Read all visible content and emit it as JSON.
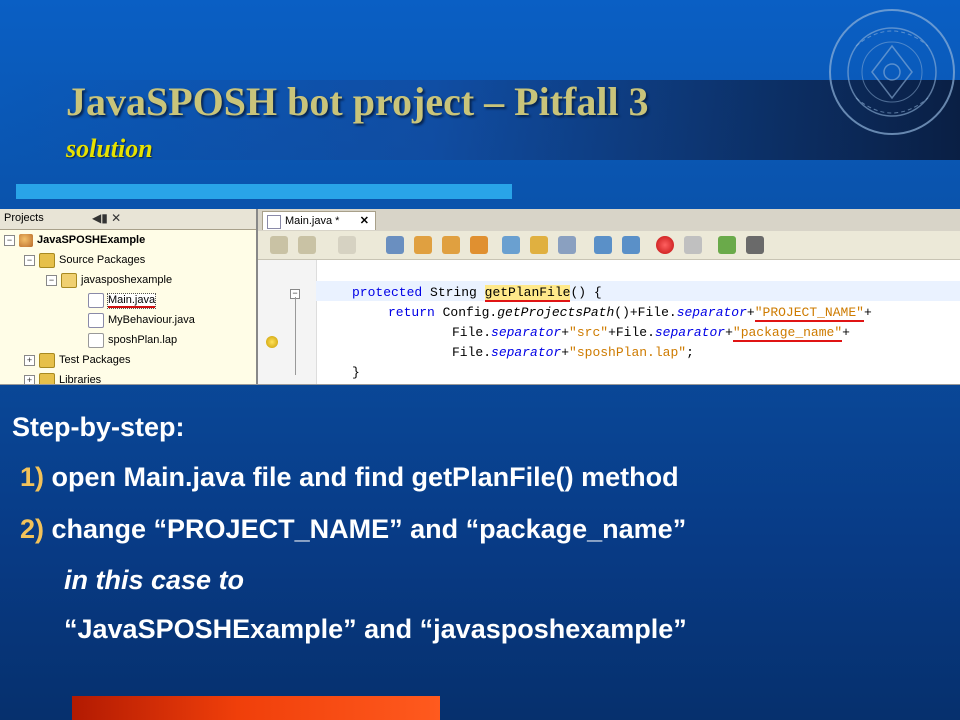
{
  "slide": {
    "title": "JavaSPOSH bot project – Pitfall 3",
    "subtitle": "solution"
  },
  "ide": {
    "projects_tab": "Projects",
    "projects_tab_controls": "◀▮ ✕",
    "tree": [
      {
        "label": "JavaSPOSHExample",
        "icon": "project-icon"
      },
      {
        "label": "Source Packages",
        "icon": "folder-icon"
      },
      {
        "label": "javasposhexample",
        "icon": "package-icon"
      },
      {
        "label": "Main.java",
        "icon": "java-file-icon"
      },
      {
        "label": "MyBehaviour.java",
        "icon": "java-file-icon"
      },
      {
        "label": "sposhPlan.lap",
        "icon": "file-icon"
      },
      {
        "label": "Test Packages",
        "icon": "folder-icon"
      },
      {
        "label": "Libraries",
        "icon": "folder-icon"
      }
    ],
    "editor_tab": "Main.java *",
    "editor_tab_close": "✕",
    "code": {
      "l1_kw": "protected",
      "l1_type": " String ",
      "l1_method": "getPlanFile",
      "l1_rest": "() {",
      "l2_kw": "return",
      "l2_a": " Config.",
      "l2_b": "getProjectsPath",
      "l2_c": "()+File.",
      "l2_d": "separator",
      "l2_e": "+",
      "l2_str": "\"PROJECT_NAME\"",
      "l2_f": "+",
      "l3_a": "File.",
      "l3_b": "separator",
      "l3_c": "+",
      "l3_str1": "\"src\"",
      "l3_d": "+File.",
      "l3_e": "separator",
      "l3_f": "+",
      "l3_str2": "\"package_name\"",
      "l3_g": "+",
      "l4_a": "File.",
      "l4_b": "separator",
      "l4_c": "+",
      "l4_str": "\"sposhPlan.lap\"",
      "l4_d": ";",
      "l5": "}"
    }
  },
  "content": {
    "heading": "Step-by-step:",
    "steps": [
      {
        "num": "1)",
        "text": " open Main.java file and find getPlanFile() method"
      },
      {
        "num": "2)",
        "text": " change “PROJECT_NAME” and “package_name”"
      }
    ],
    "note": "in this case to",
    "final": "“JavaSPOSHExample” and “javasposhexample”"
  },
  "colors": {
    "background": "#0a4c9e",
    "title": "#c9c47a",
    "subtitle": "#e6e100",
    "accent_bar": "#29a4e8",
    "bottom_bar": "#f03f0a",
    "step_number": "#f2c25a"
  }
}
